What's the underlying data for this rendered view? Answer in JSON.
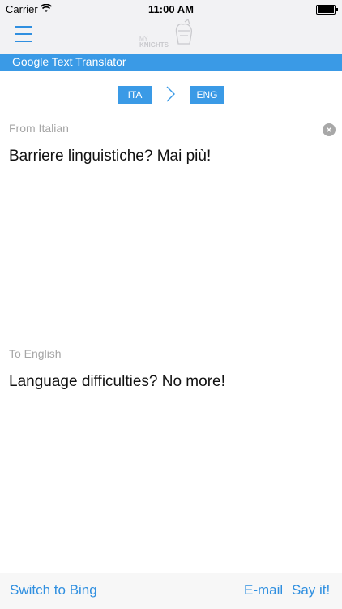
{
  "status_bar": {
    "carrier": "Carrier",
    "time": "11:00 AM"
  },
  "nav": {
    "logo_text": "KNIGHTS"
  },
  "title_strip": {
    "title": "Google Text Translator"
  },
  "language": {
    "from": "ITA",
    "to": "ENG"
  },
  "source": {
    "label": "From Italian",
    "text": "Barriere linguistiche? Mai più!"
  },
  "result": {
    "label": "To English",
    "text": "Language difficulties? No more!"
  },
  "toolbar": {
    "bing_label": "Switch to Bing",
    "email_label": "E-mail",
    "sayit_label": "Say it!"
  },
  "colors": {
    "accent": "#3a9ae6",
    "status_bg": "#f2f2f4"
  }
}
